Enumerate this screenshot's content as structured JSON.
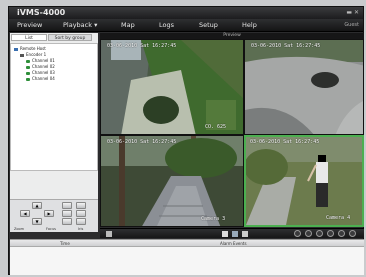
{
  "window": {
    "title": "iVMS-4000",
    "controls": "▬ ✕"
  },
  "menu": {
    "items": [
      "Preview",
      "Playback ▾",
      "Map",
      "Logs",
      "Setup",
      "Help"
    ],
    "user": "Guest"
  },
  "left_panel": {
    "tabs": [
      "List",
      "Sort by group"
    ],
    "tree": {
      "root": "Remote Host",
      "encoder": "Encoder 1",
      "channels": [
        "Channel 01",
        "Channel 02",
        "Channel 03",
        "Channel 04"
      ]
    },
    "ptz": {
      "directions": [
        "▲",
        "▼",
        "◀",
        "▶"
      ],
      "labels": [
        "Zoom",
        "Focus",
        "Iris"
      ]
    }
  },
  "preview": {
    "title": "Preview",
    "cameras": [
      {
        "timestamp": "03-06-2010 Sat 16:27:45",
        "name": "CO. 625"
      },
      {
        "timestamp": "03-06-2010 Sat 16:27:45",
        "name": ""
      },
      {
        "timestamp": "03-06-2010 Sat 16:27:45",
        "name": "Camera 3"
      },
      {
        "timestamp": "03-06-2010 Sat 16:27:45",
        "name": "Camera 4"
      }
    ]
  },
  "events": {
    "columns": [
      "Time",
      "Alarm Events"
    ]
  }
}
